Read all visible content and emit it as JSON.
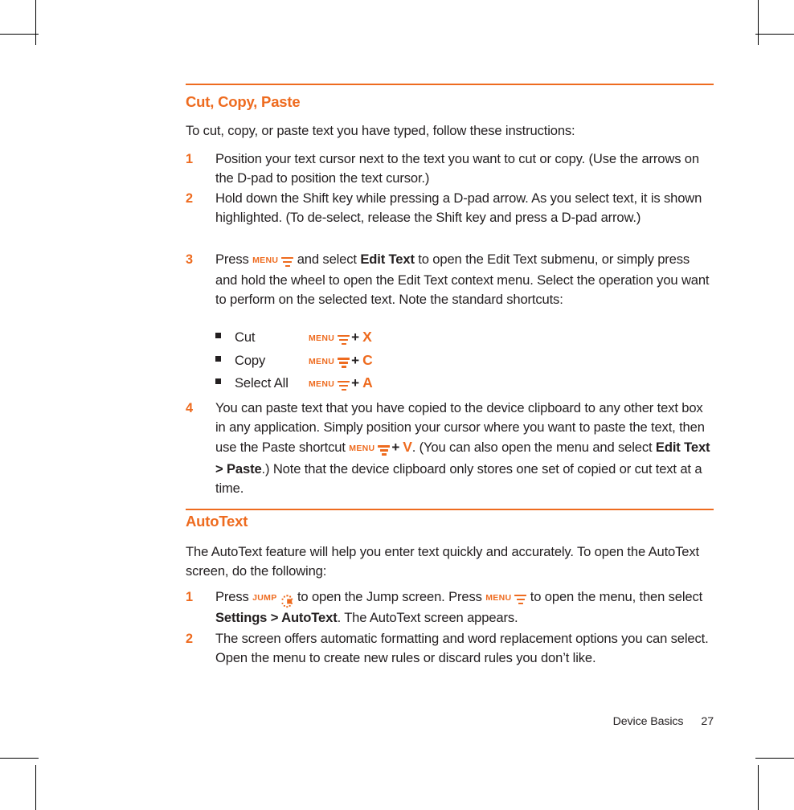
{
  "colors": {
    "accent_orange": "#ee6b1f",
    "body_text": "#231f20",
    "crop_mark": "#000000"
  },
  "sections": [
    {
      "id": "cut-copy-paste",
      "heading": "Cut, Copy, Paste",
      "intro": "To cut, copy, or paste text you have typed, follow these instructions:",
      "steps": [
        {
          "number": "1",
          "text": "Position your text cursor next to the text you want to cut or copy. (Use the arrows on the D-pad to position the text cursor.)"
        },
        {
          "number": "2",
          "text": "Hold down the Shift key while pressing a D-pad arrow. As you select text, it is shown highlighted. (To de-select, release the Shift key and press a D-pad arrow.)"
        },
        {
          "number": "3",
          "parts": {
            "p1": "Press ",
            "menu_label": "MENU",
            "p2": " and select ",
            "bold1": "Edit Text",
            "p3": " to open the Edit Text submenu, or simply press and hold the wheel to open the Edit Text context menu. Select the operation you want to perform on the selected text. Note the standard shortcuts:"
          }
        },
        {
          "number": "4",
          "parts": {
            "p1": "You can paste text that you have copied to the device clipboard to any other text box in any application. Simply position your cursor where you want to paste the text, then use the Paste shortcut ",
            "menu_label": "MENU",
            "plus": "+",
            "key": "V",
            "p2": ". (You can also open the menu and select ",
            "bold1": "Edit Text > Paste",
            "p3": ".) Note that the device clipboard only stores one set of copied or cut text at a time."
          }
        }
      ],
      "shortcuts": [
        {
          "label": "Cut",
          "menu_label": "MENU",
          "plus": "+",
          "key": "X"
        },
        {
          "label": "Copy",
          "menu_label": "MENU",
          "plus": "+",
          "key": "C"
        },
        {
          "label": "Select All",
          "menu_label": "MENU",
          "plus": "+",
          "key": "A"
        }
      ]
    },
    {
      "id": "autotext",
      "heading": "AutoText",
      "intro": "The AutoText feature will help you enter text quickly and accurately. To open the AutoText screen, do the following:",
      "steps": [
        {
          "number": "1",
          "parts": {
            "p1": "Press ",
            "jump_label": "JUMP",
            "p2": " to open the Jump screen. Press ",
            "menu_label": "MENU",
            "p3": " to open the menu, then select ",
            "bold1": "Settings > AutoText",
            "p4": ". The AutoText screen appears."
          }
        },
        {
          "number": "2",
          "text": "The screen offers automatic formatting and word replacement options you can select. Open the menu to create new rules or discard rules you don’t like."
        }
      ]
    }
  ],
  "footer": {
    "chapter": "Device Basics",
    "page_number": "27"
  }
}
